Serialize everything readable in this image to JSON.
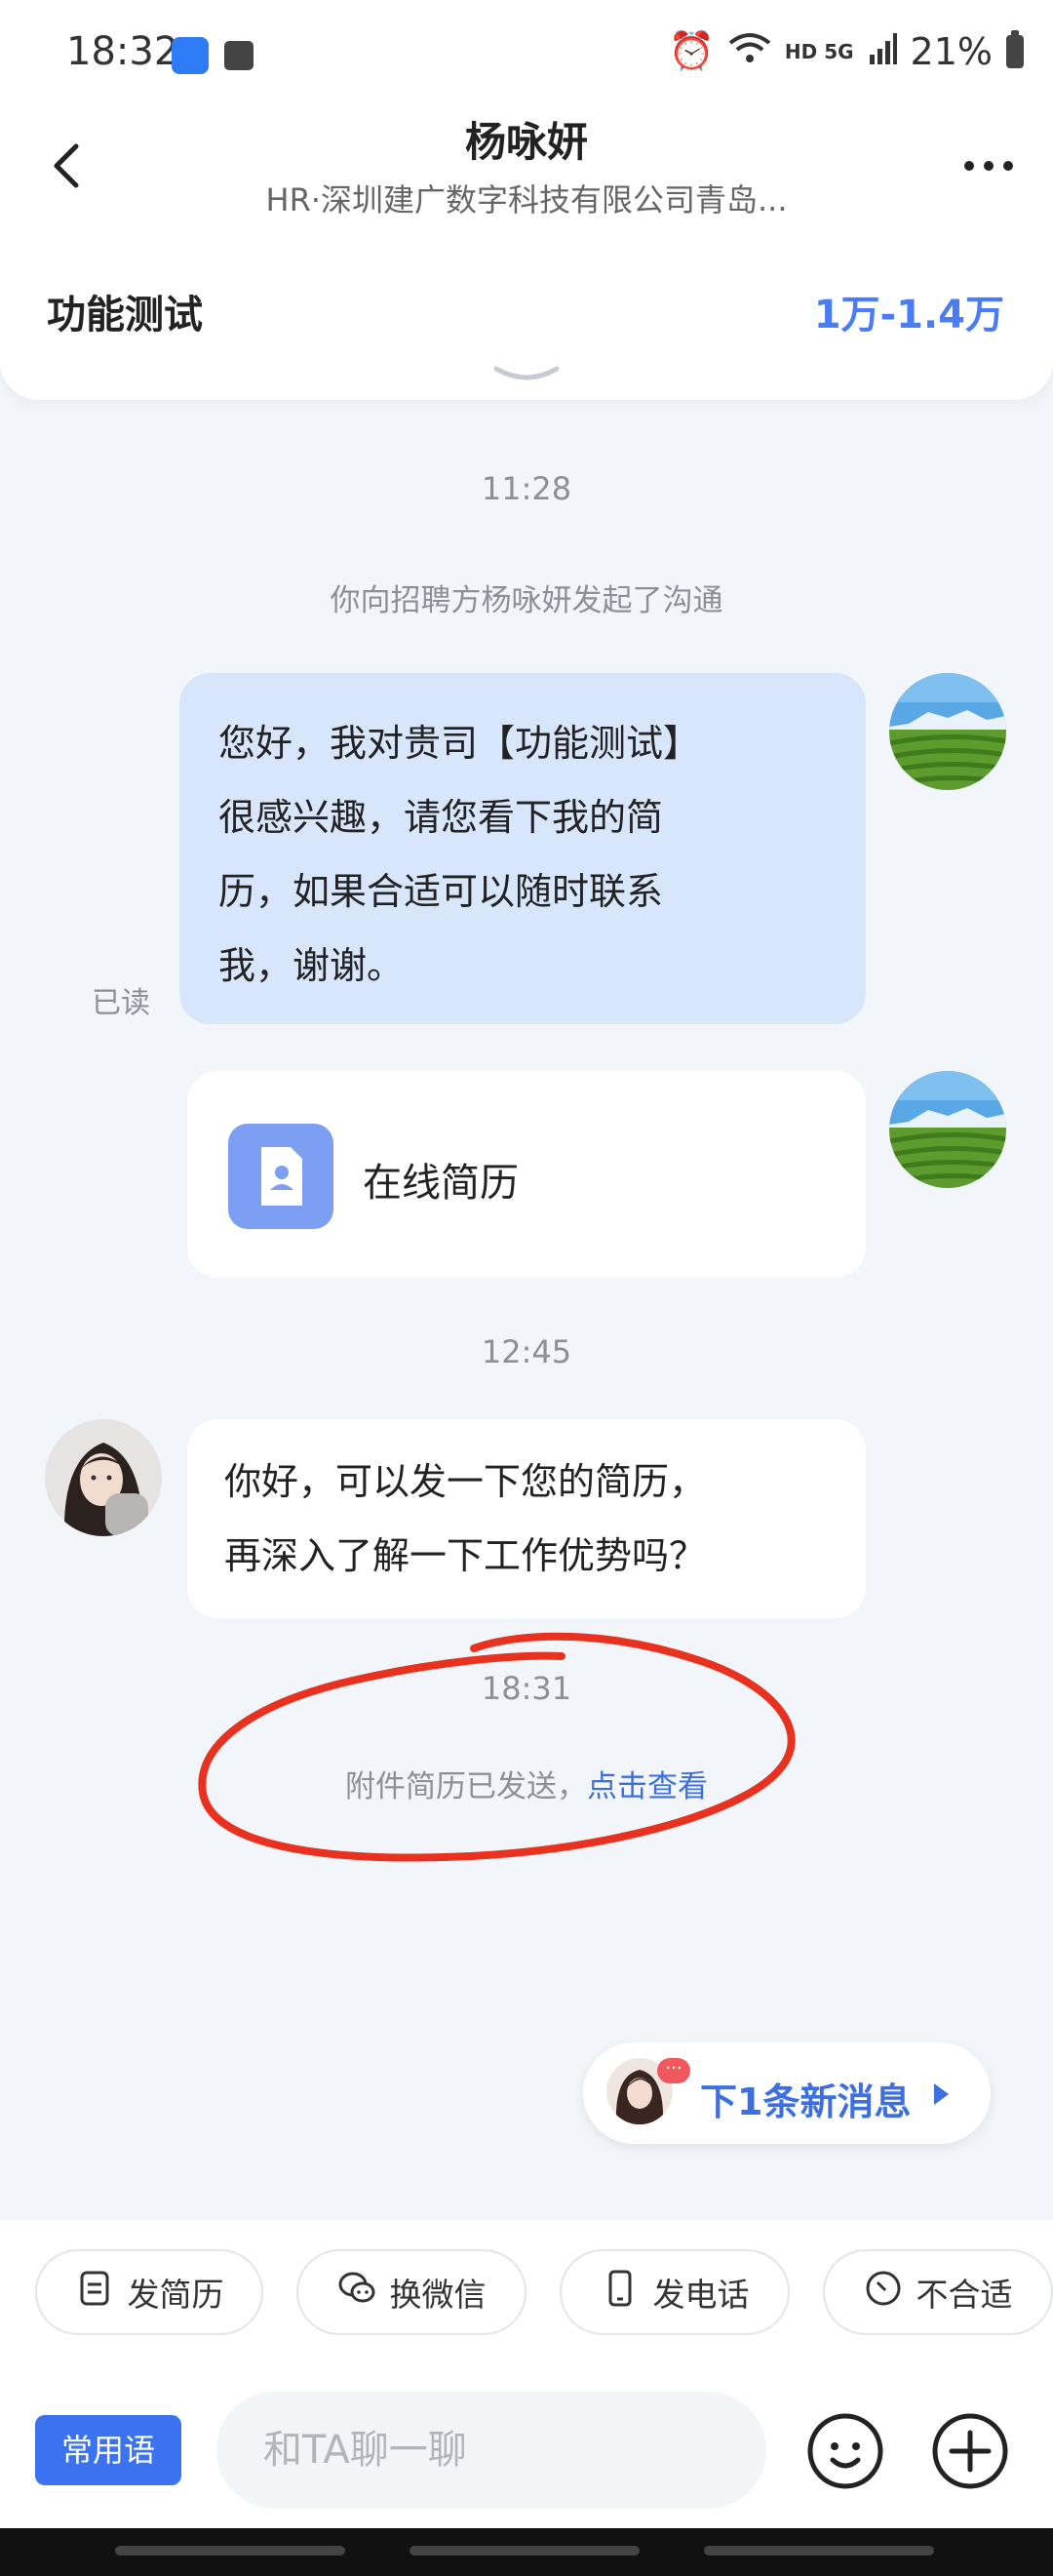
{
  "status_bar": {
    "time": "18:32",
    "right_text": "HD 5G",
    "battery": "21%"
  },
  "header": {
    "name": "杨咏妍",
    "subtitle": "HR·深圳建广数字科技有限公司青岛...",
    "job_title": "功能测试",
    "salary": "1万-1.4万"
  },
  "chat": {
    "time1": "11:28",
    "system_notice": "你向招聘方杨咏妍发起了沟通",
    "my_message_lines": [
      "您好，我对贵司【功能测试】",
      "很感兴趣，请您看下我的简",
      "历，如果合适可以随时联系",
      "我，谢谢。"
    ],
    "read_status": "已读",
    "resume_card_label": "在线简历",
    "time2": "12:45",
    "hr_message_lines": [
      "你好，可以发一下您的简历，",
      "再深入了解一下工作优势吗？"
    ],
    "time3": "18:31",
    "attachment_sent": "附件简历已发送，",
    "attachment_link": "点击查看"
  },
  "new_message": {
    "label": "下1条新消息",
    "badge": "···"
  },
  "quick_actions": [
    {
      "label": "发简历",
      "icon": "document-icon"
    },
    {
      "label": "换微信",
      "icon": "wechat-icon"
    },
    {
      "label": "发电话",
      "icon": "phone-icon"
    },
    {
      "label": "不合适",
      "icon": "no-icon"
    }
  ],
  "input_bar": {
    "phrases_label": "常用语",
    "placeholder": "和TA聊一聊"
  },
  "colors": {
    "accent": "#3a72f0",
    "salary": "#4a7df5",
    "my_bubble": "#d8e6fb",
    "annotation_red": "#e8321f"
  }
}
